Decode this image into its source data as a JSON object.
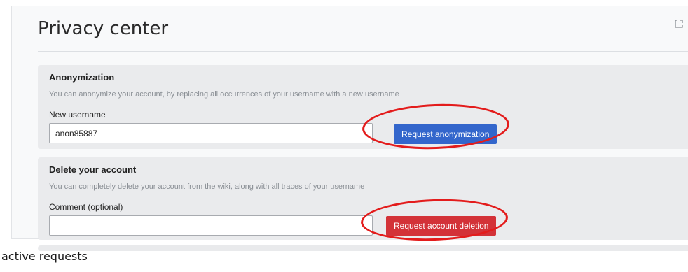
{
  "page": {
    "title": "Privacy center",
    "expand_icon": "expand-icon"
  },
  "anonymization": {
    "title": "Anonymization",
    "description": "You can anonymize your account, by replacing all occurrences of your username with a new username",
    "field_label": "New username",
    "field_value": "anon85887",
    "button_label": "Request anonymization",
    "button_color": "#3366cc"
  },
  "deletion": {
    "title": "Delete your account",
    "description": "You can completely delete your account from the wiki, along with all traces of your username",
    "field_label": "Comment (optional)",
    "field_value": "",
    "button_label": "Request account deletion",
    "button_color": "#d33238"
  },
  "annotation": {
    "highlight_color": "#e31c1c"
  },
  "footer": {
    "text": "active requests"
  }
}
